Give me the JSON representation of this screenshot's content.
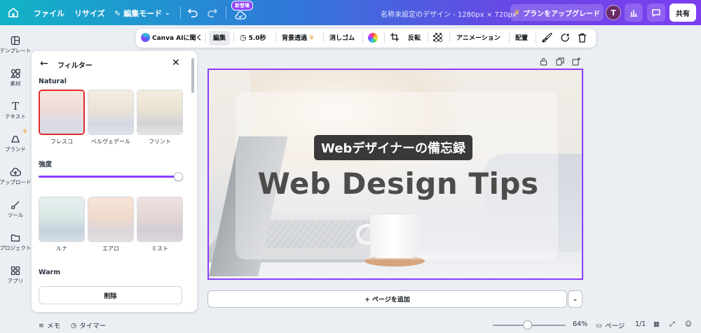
{
  "topbar": {
    "file": "ファイル",
    "resize": "リサイズ",
    "mode": "編集モード",
    "new_badge": "新登場",
    "doc_title": "名称未設定のデザイン - 1280px × 720px",
    "upgrade": "プランをアップグレード",
    "avatar_initial": "T",
    "share": "共有"
  },
  "rail": {
    "items": [
      {
        "label": "テンプレート"
      },
      {
        "label": "素材"
      },
      {
        "label": "テキスト"
      },
      {
        "label": "ブランド"
      },
      {
        "label": "アップロード"
      },
      {
        "label": "ツール"
      },
      {
        "label": "プロジェクト"
      },
      {
        "label": "アプリ"
      }
    ]
  },
  "panel": {
    "title": "フィルター",
    "section_natural": "Natural",
    "natural": [
      {
        "name": "フレスコ",
        "selected": true
      },
      {
        "name": "ベルヴェデール",
        "selected": false
      },
      {
        "name": "フリント",
        "selected": false
      }
    ],
    "intensity_label": "強度",
    "intensity_value": 1.0,
    "more": [
      {
        "name": "ルナ"
      },
      {
        "name": "エアロ"
      },
      {
        "name": "ミスト"
      }
    ],
    "section_warm": "Warm",
    "delete": "削除"
  },
  "edit_toolbar": {
    "canva_ai": "Canva AIに聞く",
    "edit": "編集",
    "duration": "5.0秒",
    "bg_remove": "背景透過",
    "eraser": "消しゴム",
    "flip": "反転",
    "animation": "アニメーション",
    "arrange": "配置"
  },
  "canvas": {
    "subtitle": "Webデザイナーの備忘録",
    "title": "Web Design Tips",
    "add_page": "+ ページを追加"
  },
  "bottombar": {
    "notes": "メモ",
    "timer": "タイマー",
    "zoom": "64%",
    "pages": "ページ",
    "page_count": "1/1"
  },
  "colors": {
    "accent": "#8b3dff",
    "selected_border": "#e02a2a",
    "crown": "#f2a83a"
  }
}
